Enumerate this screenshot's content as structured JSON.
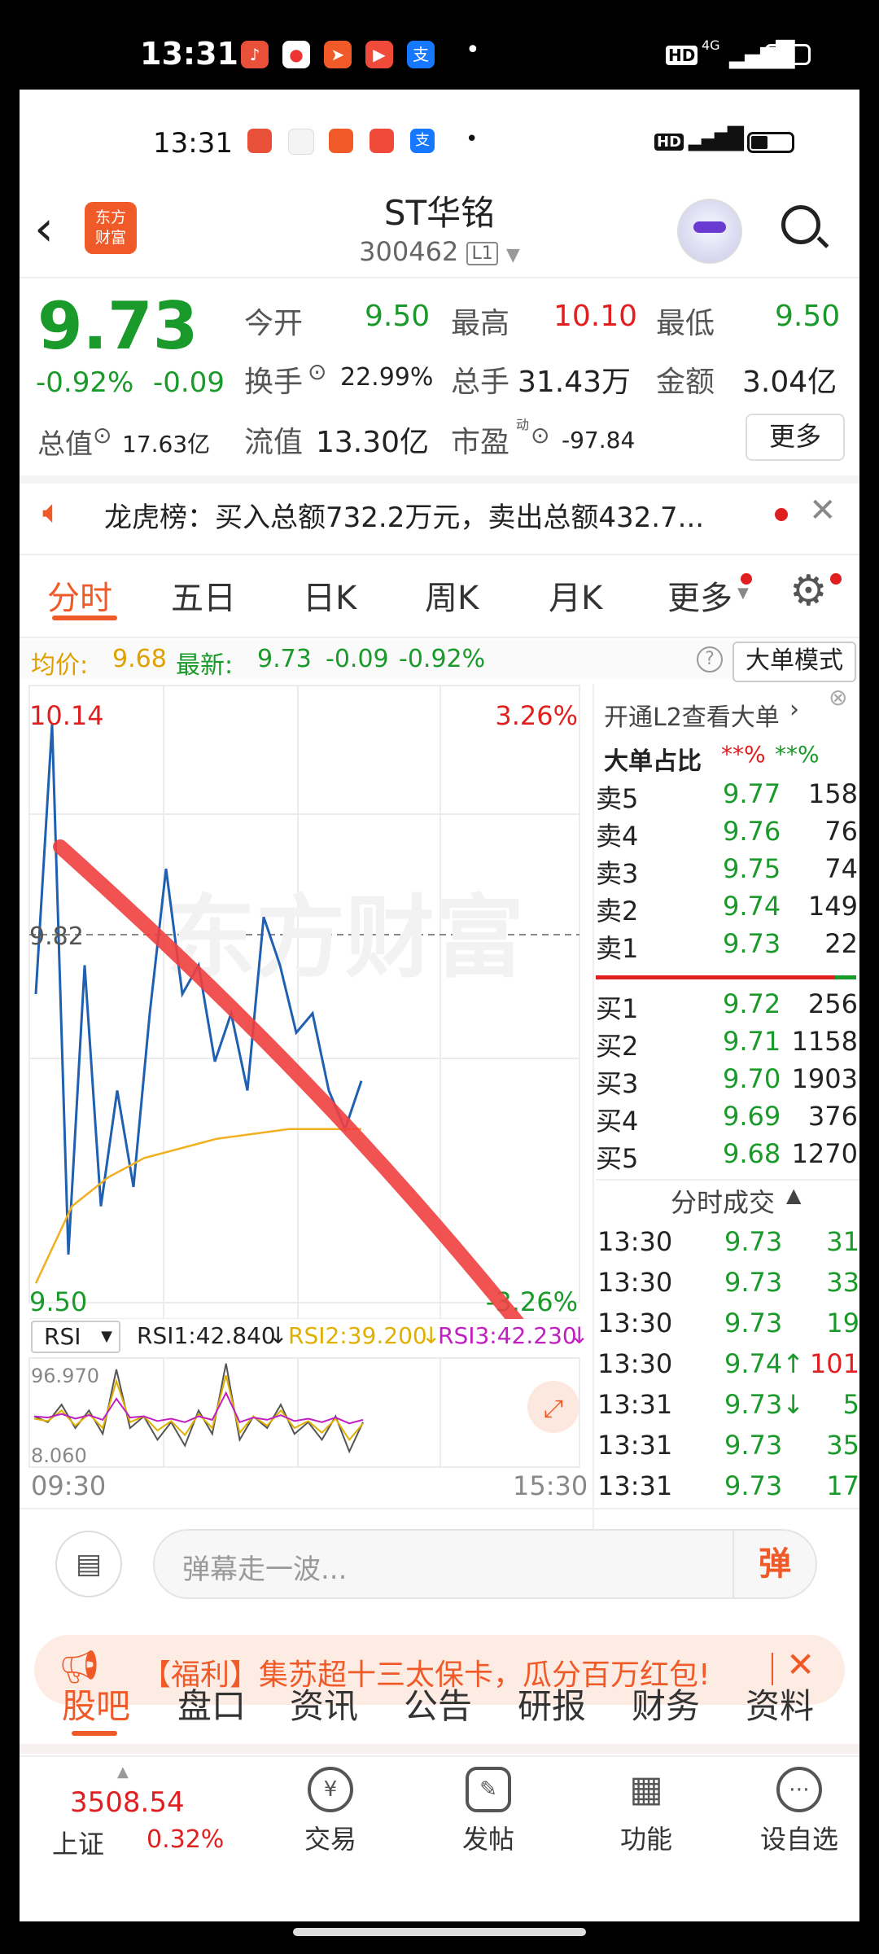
{
  "status": {
    "time": "13:31",
    "hd": "HD",
    "net": "4G"
  },
  "header": {
    "brand_line1": "东方",
    "brand_line2": "财富",
    "title": "ST华铭",
    "code": "300462",
    "level": "L1"
  },
  "quote": {
    "price": "9.73",
    "change_pct": "-0.92%",
    "change": "-0.09",
    "open_label": "今开",
    "open": "9.50",
    "high_label": "最高",
    "high": "10.10",
    "low_label": "最低",
    "low": "9.50",
    "turnover_label": "换手",
    "turnover": "22.99%",
    "volume_label": "总手",
    "volume": "31.43万",
    "amount_label": "金额",
    "amount": "3.04亿",
    "mktcap_label": "总值",
    "mktcap": "17.63亿",
    "float_label": "流值",
    "float": "13.30亿",
    "pe_label": "市盈",
    "pe_sup": "动",
    "pe": "-97.84",
    "more": "更多"
  },
  "notice": {
    "text": "龙虎榜：买入总额732.2万元，卖出总额432.7..."
  },
  "chart_tabs": [
    "分时",
    "五日",
    "日K",
    "周K",
    "月K",
    "更多"
  ],
  "price_line": {
    "avg_label": "均价:",
    "avg": "9.68",
    "latest_label": "最新:",
    "latest": "9.73",
    "chg": "-0.09",
    "pct": "-0.92%",
    "mode_button": "大单模式"
  },
  "chart_data": [
    {
      "type": "line",
      "x": [
        "09:30",
        "15:30"
      ],
      "y_labels": {
        "top": "10.14",
        "mid": "9.82",
        "bottom": "9.50",
        "top_pct": "3.26%",
        "bottom_pct": "-3.26%"
      },
      "ylim": [
        9.5,
        10.14
      ],
      "series": [
        {
          "values": [
            9.82,
            10.1,
            9.55,
            9.85,
            9.6,
            9.72,
            9.62,
            9.8,
            9.95,
            9.82,
            9.85,
            9.75,
            9.8,
            9.72,
            9.9,
            9.85,
            9.78,
            9.8,
            9.72,
            9.68,
            9.73
          ],
          "color": "#2060b0"
        },
        {
          "values": [
            9.52,
            9.6,
            9.63,
            9.65,
            9.66,
            9.67,
            9.675,
            9.68,
            9.68,
            9.68
          ],
          "color": "#f0b020"
        }
      ]
    },
    {
      "type": "line",
      "indicator": "RSI",
      "labels": {
        "rsi1": "RSI1:42.840",
        "rsi2": "RSI2:39.200",
        "rsi3": "RSI3:42.230",
        "top": "96.970",
        "bottom": "8.060"
      },
      "ylim": [
        8.06,
        96.97
      ],
      "series": [
        {
          "name": "RSI1",
          "values": [
            50,
            45,
            60,
            40,
            55,
            35,
            90,
            40,
            50,
            30,
            45,
            25,
            55,
            35,
            95,
            30,
            50,
            40,
            60,
            35,
            45,
            30,
            50,
            20,
            45
          ]
        },
        {
          "name": "RSI2",
          "values": [
            48,
            46,
            55,
            42,
            52,
            40,
            80,
            45,
            50,
            38,
            46,
            34,
            52,
            40,
            85,
            36,
            50,
            42,
            55,
            40,
            46,
            36,
            48,
            30,
            44
          ]
        },
        {
          "name": "RSI3",
          "values": [
            50,
            49,
            52,
            48,
            51,
            47,
            65,
            49,
            50,
            46,
            48,
            45,
            50,
            47,
            70,
            45,
            49,
            47,
            51,
            46,
            48,
            45,
            49,
            44,
            47
          ]
        }
      ]
    }
  ],
  "orderbook": {
    "promo": "开通L2查看大单",
    "ratio_label": "大单占比",
    "ratio_red": "**%",
    "ratio_green": "**%",
    "sells": [
      {
        "label": "卖5",
        "price": "9.77",
        "vol": "158"
      },
      {
        "label": "卖4",
        "price": "9.76",
        "vol": "76"
      },
      {
        "label": "卖3",
        "price": "9.75",
        "vol": "74"
      },
      {
        "label": "卖2",
        "price": "9.74",
        "vol": "149"
      },
      {
        "label": "卖1",
        "price": "9.73",
        "vol": "22"
      }
    ],
    "buys": [
      {
        "label": "买1",
        "price": "9.72",
        "vol": "256"
      },
      {
        "label": "买2",
        "price": "9.71",
        "vol": "1158"
      },
      {
        "label": "买3",
        "price": "9.70",
        "vol": "1903"
      },
      {
        "label": "买4",
        "price": "9.69",
        "vol": "376"
      },
      {
        "label": "买5",
        "price": "9.68",
        "vol": "1270"
      }
    ]
  },
  "trades": {
    "title": "分时成交",
    "rows": [
      {
        "time": "13:30",
        "price": "9.73",
        "vol": "31"
      },
      {
        "time": "13:30",
        "price": "9.73",
        "vol": "33"
      },
      {
        "time": "13:30",
        "price": "9.73",
        "vol": "19"
      },
      {
        "time": "13:30",
        "price": "9.74↑",
        "vol": "101"
      },
      {
        "time": "13:31",
        "price": "9.73↓",
        "vol": "5"
      },
      {
        "time": "13:31",
        "price": "9.73",
        "vol": "35"
      },
      {
        "time": "13:31",
        "price": "9.73",
        "vol": "17"
      }
    ]
  },
  "comment": {
    "placeholder": "弹幕走一波...",
    "danmu": "弹"
  },
  "promo_banner": {
    "text": "【福利】集苏超十三太保卡，瓜分百万红包!"
  },
  "bottom_tabs": [
    "股吧",
    "盘口",
    "资讯",
    "公告",
    "研报",
    "财务",
    "资料"
  ],
  "index": {
    "value": "3508.54",
    "name": "上证",
    "pct": "0.32%"
  },
  "nav": [
    "交易",
    "发帖",
    "功能",
    "设自选"
  ]
}
